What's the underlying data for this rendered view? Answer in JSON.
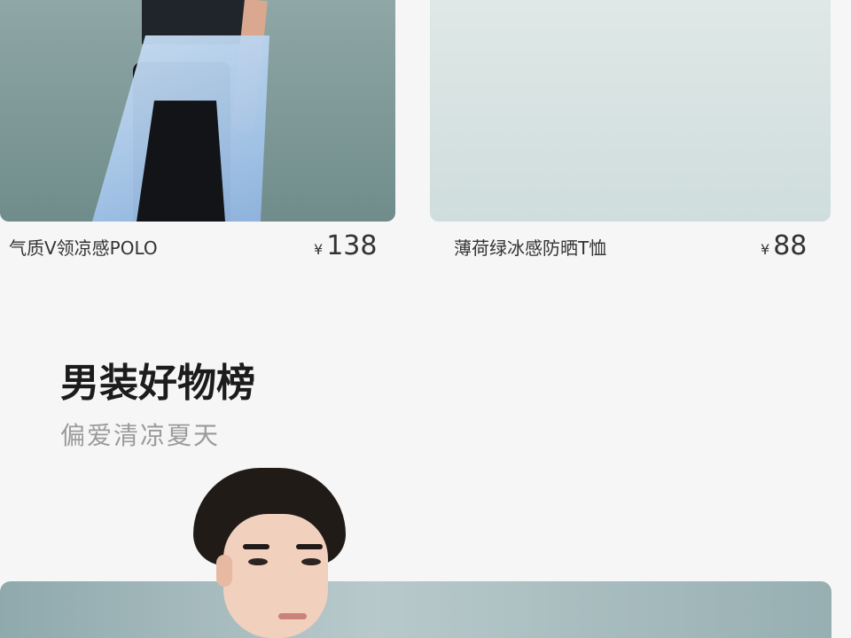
{
  "products": [
    {
      "name": "气质V领凉感POLO",
      "currency": "¥",
      "price": "138"
    },
    {
      "name": "薄荷绿冰感防晒T恤",
      "currency": "¥",
      "price": "88"
    }
  ],
  "section": {
    "title": "男装好物榜",
    "subtitle": "偏爱清凉夏天"
  },
  "colors": {
    "background": "#f6f6f6",
    "title": "#1c1c1c",
    "subtitle": "#9b9b9b"
  }
}
